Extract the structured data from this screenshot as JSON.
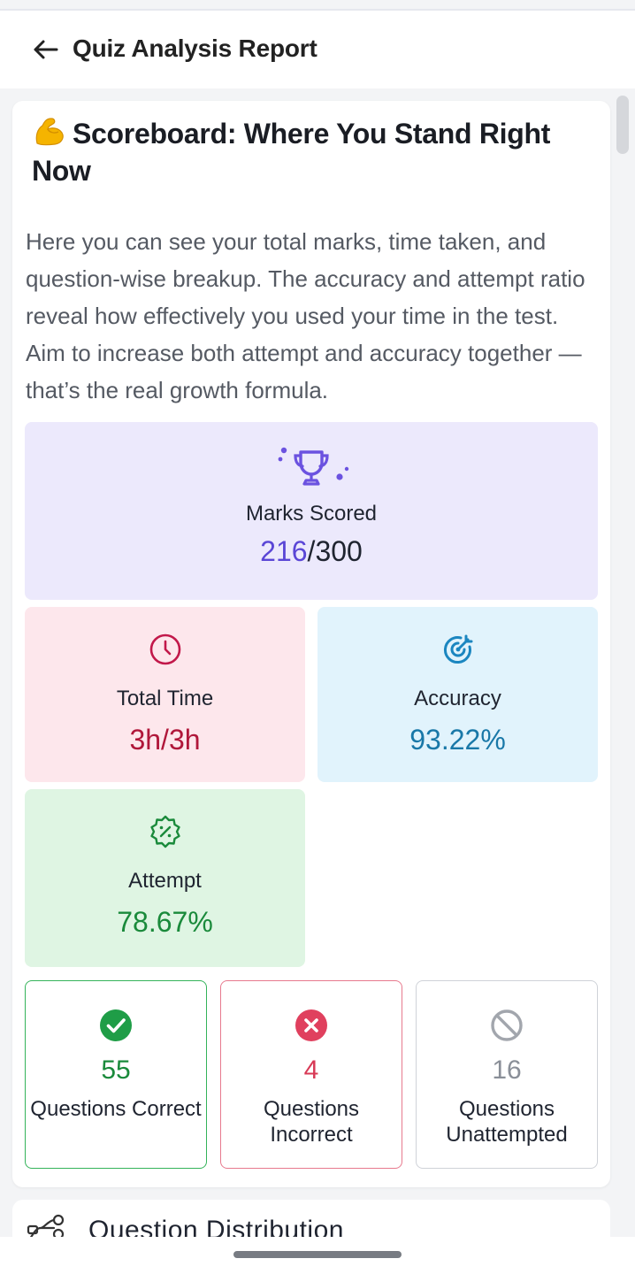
{
  "header": {
    "title": "Quiz Analysis Report"
  },
  "scoreboard": {
    "emoji": "💪",
    "title": "Scoreboard: Where You Stand Right Now",
    "description": "Here you can see your total marks, time taken, and question-wise breakup. The accuracy and attempt ratio reveal how effectively you used your time in the test. Aim to increase both attempt and accuracy together — that’s the real growth formula."
  },
  "marks": {
    "label": "Marks Scored",
    "scored": "216",
    "separator": "/",
    "total": "300",
    "icon": "trophy-icon",
    "color": "#5a46d6"
  },
  "total_time": {
    "label": "Total Time",
    "value": "3h/3h",
    "icon": "clock-icon",
    "color": "#b0173a"
  },
  "accuracy": {
    "label": "Accuracy",
    "value": "93.22%",
    "icon": "target-icon",
    "color": "#1978a8"
  },
  "attempt": {
    "label": "Attempt",
    "value": "78.67%",
    "icon": "percent-badge-icon",
    "color": "#1a8a3b"
  },
  "questions": [
    {
      "count": "55",
      "label": "Questions Correct",
      "icon": "check-circle-icon",
      "color": "#1a8a3b"
    },
    {
      "count": "4",
      "label": "Questions Incorrect",
      "icon": "x-circle-icon",
      "color": "#d83a56"
    },
    {
      "count": "16",
      "label": "Questions Unattempted",
      "icon": "ban-icon",
      "color": "#8a8f98"
    }
  ],
  "next_section": {
    "title": "Question Distribution",
    "icon": "distribution-icon"
  }
}
